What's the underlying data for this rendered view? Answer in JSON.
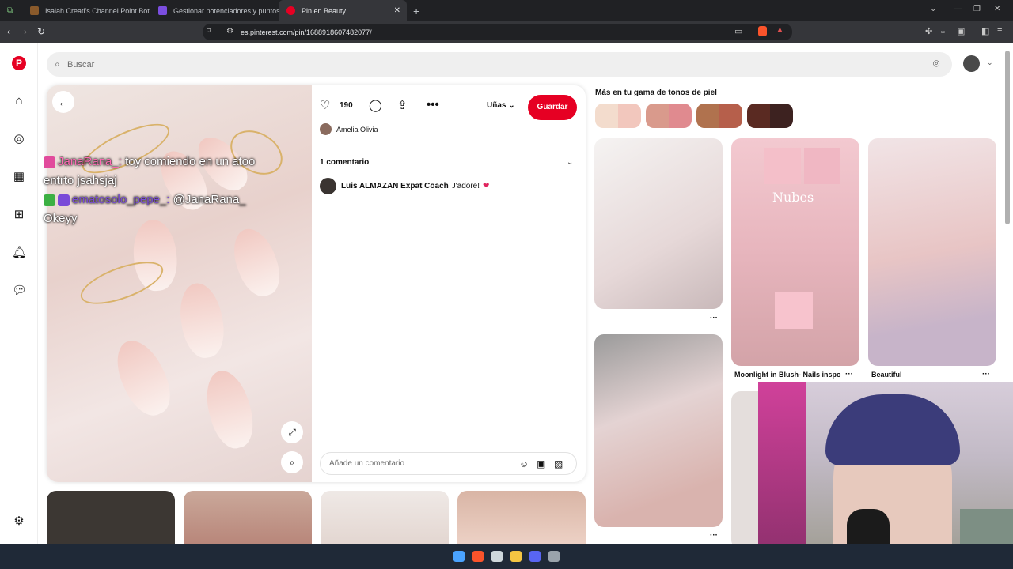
{
  "browser": {
    "tabs": [
      {
        "title": "Isaiah Creati's Channel Point Bot - Da",
        "color": "#8a5a2b"
      },
      {
        "title": "Gestionar potenciadores y puntos de",
        "color": "#7b4ee0"
      },
      {
        "title": "Pin en Beauty",
        "color": "#e60023",
        "active": true
      }
    ],
    "url": "es.pinterest.com/pin/1688918607482077/"
  },
  "search": {
    "placeholder": "Buscar"
  },
  "pin": {
    "likes": "190",
    "board": "Uñas",
    "save_label": "Guardar",
    "author": "Amelia Olivia",
    "comments_header": "1 comentario",
    "comment": {
      "user": "Luis ALMAZAN Expat Coach",
      "text": "J'adore!",
      "emoji": "❤"
    },
    "add_comment_placeholder": "Añade un comentario"
  },
  "chat": [
    {
      "user": "JanaRana_:",
      "message": "toy comiendo en un atoo entrto jsahsjaj"
    },
    {
      "user": "ematosolo_pepe_:",
      "message": "@JanaRana_ Okeyy"
    }
  ],
  "related": {
    "title": "Más en tu gama de tonos de piel",
    "swatches": [
      [
        "#f3dccd",
        "#f2c7bd"
      ],
      [
        "#d99a8c",
        "#e08a8f"
      ],
      [
        "#b0724e",
        "#b65f4b"
      ],
      [
        "#5a2a22",
        "#3d2220"
      ]
    ],
    "captions": {
      "moonlight": "Moonlight in Blush- Nails inspo",
      "beautiful": "Beautiful"
    }
  },
  "colors": {
    "brand": "#e60023"
  }
}
